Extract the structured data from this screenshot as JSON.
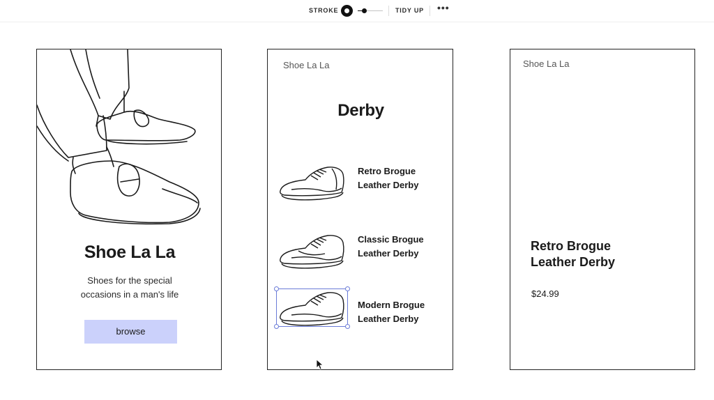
{
  "toolbar": {
    "stroke_label": "STROKE",
    "tidy_label": "TIDY UP",
    "more_label": "•••"
  },
  "frame1": {
    "title": "Shoe La La",
    "subtitle_line1": "Shoes for the special",
    "subtitle_line2": "occasions in a man's life",
    "button_label": "browse",
    "button_color": "#cbd1fb"
  },
  "frame2": {
    "brand": "Shoe La La",
    "title": "Derby",
    "products": [
      {
        "line1": "Retro Brogue",
        "line2": "Leather Derby"
      },
      {
        "line1": "Classic Brogue",
        "line2": "Leather Derby"
      },
      {
        "line1": "Modern Brogue",
        "line2": "Leather Derby"
      }
    ]
  },
  "frame3": {
    "brand": "Shoe La La",
    "title_line1": "Retro Brogue",
    "title_line2": "Leather Derby",
    "price": "$24.99"
  },
  "selection_color": "#6a7bd8"
}
